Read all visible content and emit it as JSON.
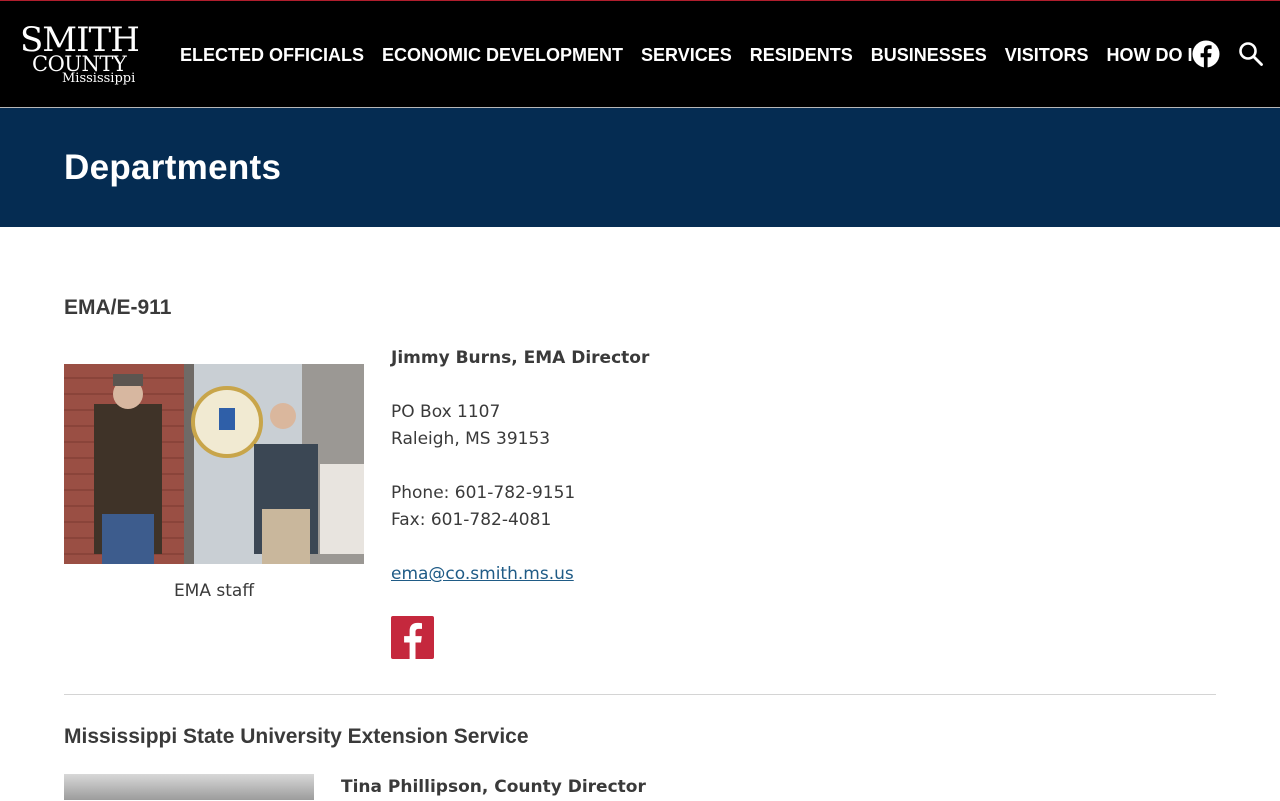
{
  "header": {
    "logo": {
      "line1": "SMITH",
      "line2": "COUNTY",
      "line3": "Mississippi"
    },
    "nav": [
      {
        "label": "ELECTED OFFICIALS"
      },
      {
        "label": "ECONOMIC DEVELOPMENT"
      },
      {
        "label": "SERVICES"
      },
      {
        "label": "RESIDENTS"
      },
      {
        "label": "BUSINESSES"
      },
      {
        "label": "VISITORS"
      },
      {
        "label": "HOW DO I?"
      }
    ],
    "icons": {
      "facebook": "facebook-icon",
      "search": "search-icon"
    }
  },
  "banner": {
    "title": "Departments"
  },
  "departments": [
    {
      "title": "EMA/E-911",
      "photo_caption": "EMA staff",
      "contact_name": "Jimmy Burns, EMA Director",
      "address_line1": "PO Box 1107",
      "address_line2": "Raleigh, MS 39153",
      "phone": "Phone: 601-782-9151",
      "fax": "Fax: 601-782-4081",
      "email": "ema@co.smith.ms.us",
      "social_icon": "facebook-square-icon"
    },
    {
      "title": "Mississippi State University Extension Service",
      "contact_name": "Tina Phillipson, County Director"
    }
  ],
  "colors": {
    "header_bg": "#000000",
    "banner_bg": "#052c52",
    "accent_red": "#c5283d",
    "link_blue": "#1f5b86"
  }
}
